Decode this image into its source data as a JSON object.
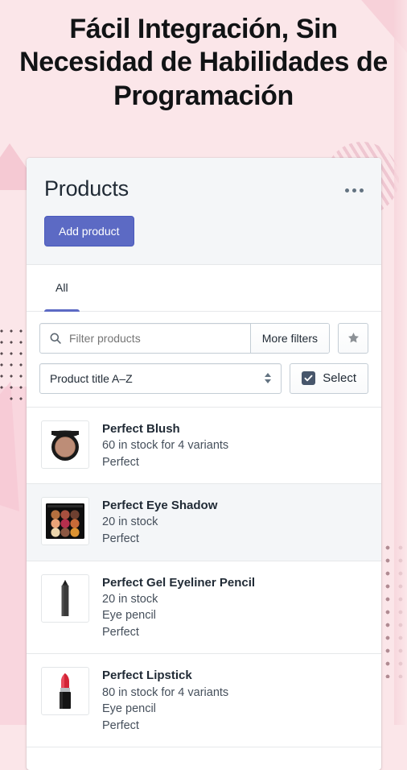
{
  "headline": "Fácil Integración, Sin Necesidad de Habilidades de Programación",
  "card": {
    "title": "Products",
    "menu_icon": "ellipsis-horizontal-icon",
    "add_product_label": "Add product",
    "tabs": [
      {
        "label": "All",
        "active": true
      }
    ],
    "filters": {
      "search_icon": "search-icon",
      "search_placeholder": "Filter products",
      "search_value": "",
      "more_filters_label": "More filters",
      "star_icon": "star-icon",
      "sort_value": "Product title A–Z",
      "sort_icon": "select-spinner-icon",
      "select_label": "Select",
      "select_checked": true,
      "check_icon": "checkmark-icon"
    },
    "products": [
      {
        "title": "Perfect Blush",
        "stock": "60 in stock for 4 variants",
        "type": "",
        "vendor": "Perfect",
        "thumb": "blush-compact-thumbnail"
      },
      {
        "title": "Perfect Eye Shadow",
        "stock": "20 in stock",
        "type": "",
        "vendor": "Perfect",
        "thumb": "eyeshadow-palette-thumbnail"
      },
      {
        "title": "Perfect Gel Eyeliner Pencil",
        "stock": "20 in stock",
        "type": "Eye pencil",
        "vendor": "Perfect",
        "thumb": "eyeliner-pencil-thumbnail"
      },
      {
        "title": "Perfect Lipstick",
        "stock": "80 in stock for 4 variants",
        "type": "Eye pencil",
        "vendor": "Perfect",
        "thumb": "lipstick-thumbnail"
      }
    ]
  },
  "colors": {
    "background": "#fbe6e9",
    "accent": "#5c6ac4",
    "card_header": "#f4f6f8",
    "text": "#212b36",
    "muted": "#637381",
    "border": "#c4cdd5",
    "decor_pink": "#f4c2cd",
    "decor_dot": "#b08b92"
  }
}
